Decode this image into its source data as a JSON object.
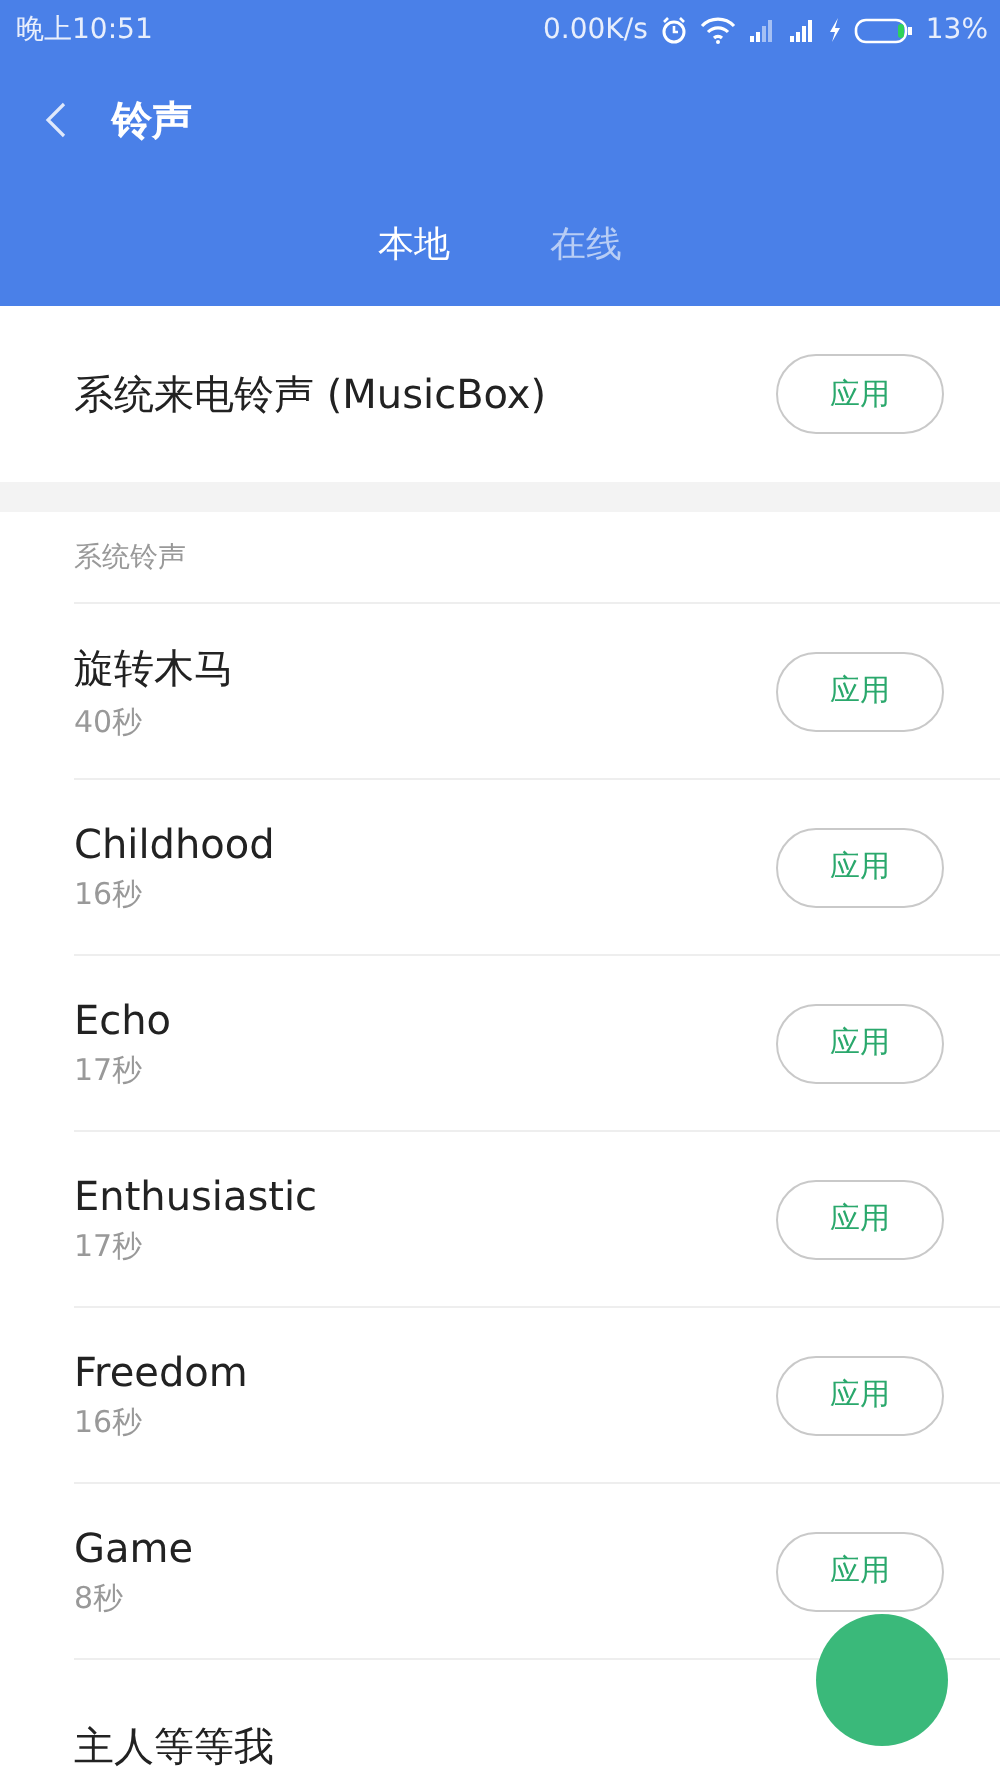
{
  "status_bar": {
    "time": "晚上10:51",
    "speed": "0.00K/s",
    "battery": "13%"
  },
  "header": {
    "title": "铃声"
  },
  "tabs": [
    {
      "label": "本地",
      "selected": true
    },
    {
      "label": "在线",
      "selected": false
    }
  ],
  "current": {
    "title": "系统来电铃声 (MusicBox)",
    "button": "应用"
  },
  "section": {
    "title": "系统铃声",
    "items": [
      {
        "title": "旋转木马",
        "duration": "40秒",
        "button": "应用"
      },
      {
        "title": "Childhood",
        "duration": "16秒",
        "button": "应用"
      },
      {
        "title": "Echo",
        "duration": "17秒",
        "button": "应用"
      },
      {
        "title": "Enthusiastic",
        "duration": "17秒",
        "button": "应用"
      },
      {
        "title": "Freedom",
        "duration": "16秒",
        "button": "应用"
      },
      {
        "title": "Game",
        "duration": "8秒",
        "button": "应用"
      },
      {
        "title": "主人等等我"
      }
    ]
  }
}
